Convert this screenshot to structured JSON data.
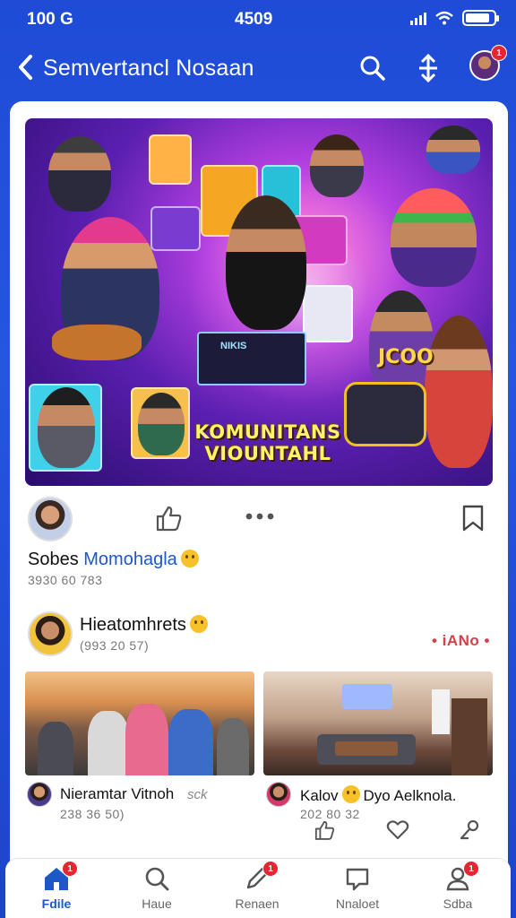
{
  "status": {
    "time": "100 G",
    "center": "4509",
    "battery_level": 0.85
  },
  "header": {
    "back_symbol": "<",
    "title": "Semvertancl Nosaan",
    "notif_count": "1"
  },
  "hero": {
    "caption_line1": "KOMUNITANS",
    "caption_line2": "VIOUNTAHL",
    "sign_text": "JCOO",
    "laptop_text": "NIKIS"
  },
  "post1": {
    "name_prefix": "Sobes ",
    "name_blue": "Momohagla",
    "meta": "3930 60 783"
  },
  "post2": {
    "name": "Hieatomhrets",
    "meta": "(993 20 57)",
    "tag": "• iANo •"
  },
  "thumb_left": {
    "name": "Nieramtar Vitnoh",
    "extra": "sck",
    "meta": "238 36 50)"
  },
  "thumb_right": {
    "name_a": "Kalov",
    "name_b": "Dyo Aelknola.",
    "meta": "202 80 32"
  },
  "nav": [
    {
      "label": "Fdile",
      "icon": "home-icon",
      "badge": "1"
    },
    {
      "label": "Haue",
      "icon": "search-icon",
      "badge": ""
    },
    {
      "label": "Renaen",
      "icon": "create-icon",
      "badge": "1"
    },
    {
      "label": "Nnaloet",
      "icon": "message-icon",
      "badge": ""
    },
    {
      "label": "Sdba",
      "icon": "profile-icon",
      "badge": "1"
    }
  ],
  "colors": {
    "brand": "#1f4bd6",
    "accent_blue": "#1d58c7",
    "badge": "#e3262f"
  }
}
